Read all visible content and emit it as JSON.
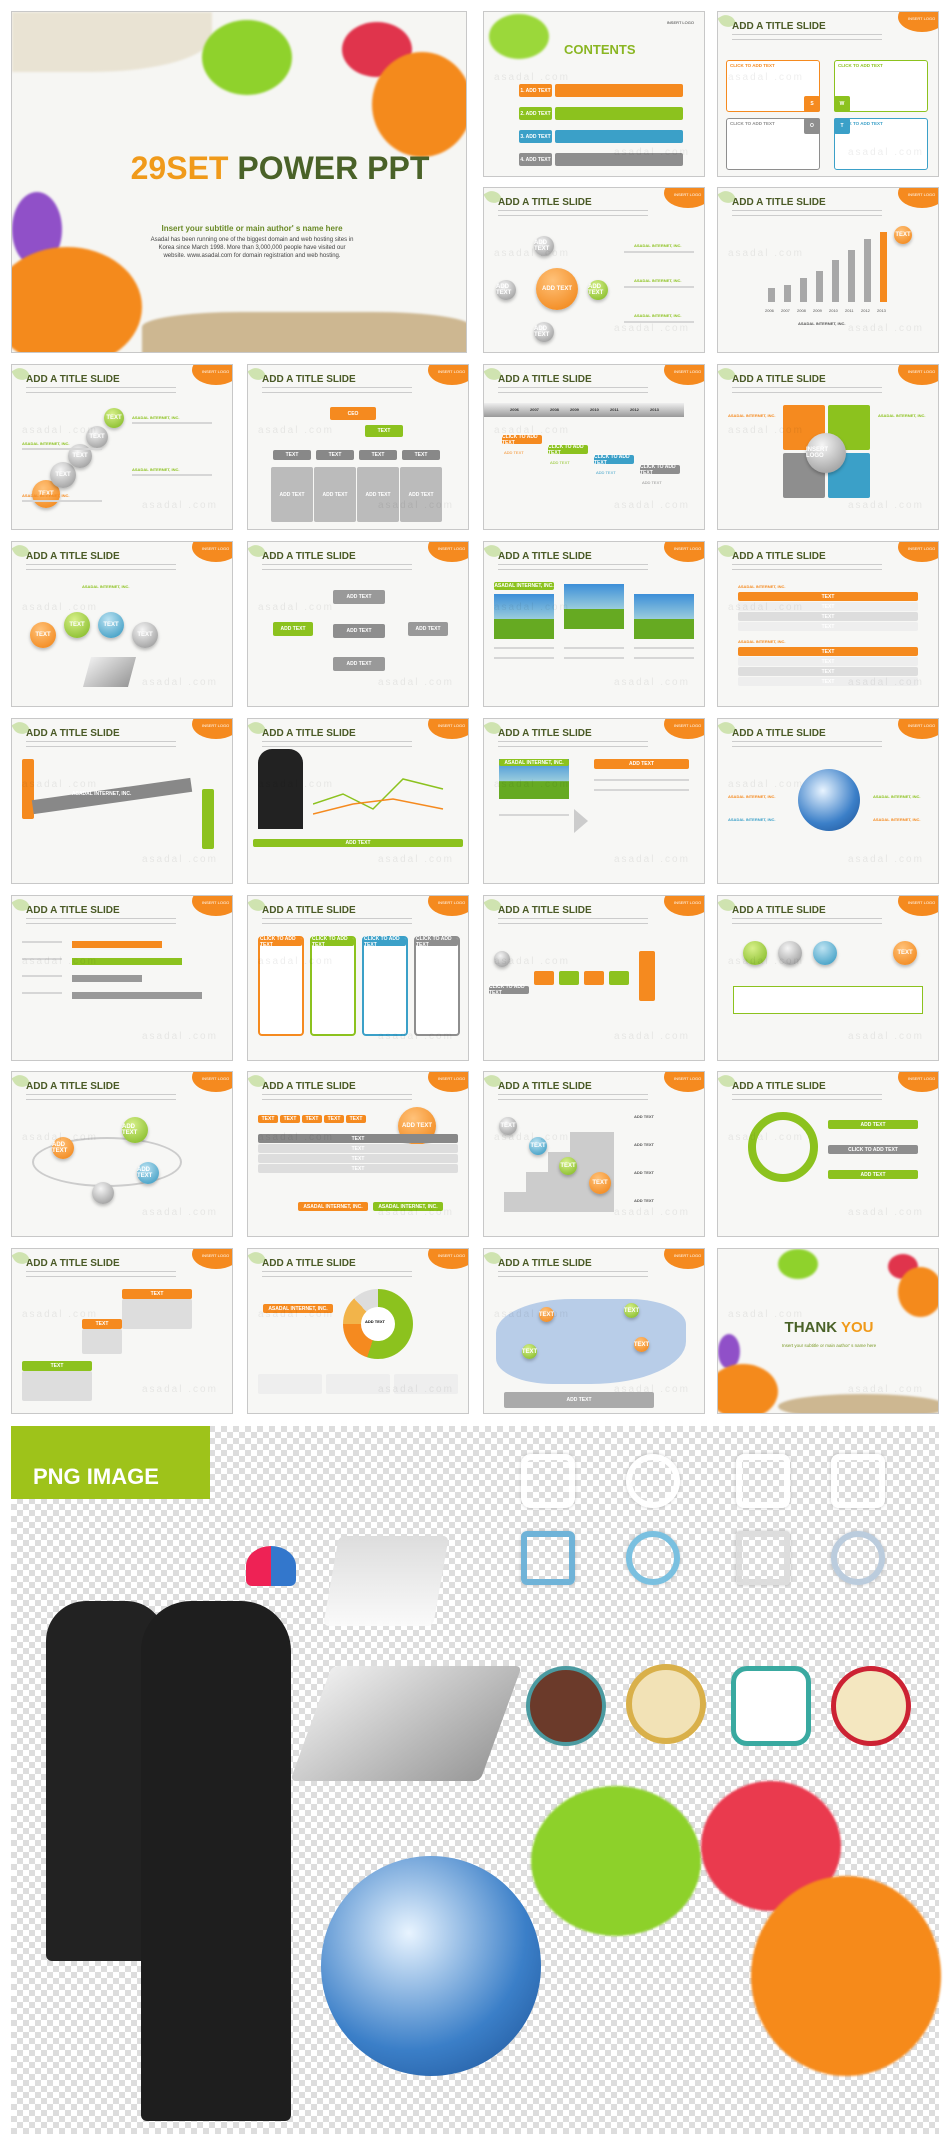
{
  "title_slide": {
    "title_a": "29SET",
    "title_b": "POWER PPT",
    "subtitle": "Insert your subtitle or main author'  s name here",
    "body": "Asadal has been running one of the biggest domain and web hosting sites in Korea since March 1998. More than 3,000,000 people have visited our website. www.asadal.com for domain  registration and web hosting.",
    "watermark": "asadal.com"
  },
  "common": {
    "slide_title": "ADD A TITLE SLIDE",
    "logo": "INSERT LOGO",
    "watermark": "asadal .com"
  },
  "contents_slide": {
    "title": "CONTENTS",
    "items": [
      "1. ADD TEXT",
      "2. ADD TEXT",
      "3. ADD TEXT",
      "4. ADD TEXT"
    ]
  },
  "swot": {
    "heading": "CLICK TO ADD TEXT",
    "letters": [
      "S",
      "W",
      "O",
      "T"
    ]
  },
  "cycle": {
    "center": "ADD TEXT",
    "center_sub": "CLICK TO ADD TEXT",
    "node": "ADD TEXT",
    "caption": "ASADAL INTERNET, INC."
  },
  "bar_chart": {
    "years": [
      "2006",
      "2007",
      "2008",
      "2009",
      "2010",
      "2011",
      "2012",
      "2013"
    ],
    "values": [
      2,
      2.5,
      3.5,
      4.5,
      6,
      7.5,
      9,
      10
    ],
    "badge": "TEXT",
    "caption": "ASADAL INTERNET, INC."
  },
  "steps": {
    "label": "TEXT",
    "caption": "ASADAL INTERNET, INC."
  },
  "org": {
    "ceo": "CEO",
    "sub": "TEXT",
    "cols": [
      "TEXT",
      "TEXT",
      "TEXT",
      "TEXT"
    ],
    "heads": [
      "ADD TEXT",
      "ADD TEXT",
      "ADD TEXT",
      "ADD TEXT"
    ]
  },
  "timeline": {
    "years": [
      "2006",
      "2007",
      "2008",
      "2009",
      "2010",
      "2011",
      "2012",
      "2013"
    ],
    "tags": [
      "CLICK TO ADD TEXT",
      "CLICK TO ADD TEXT",
      "CLICK TO ADD TEXT",
      "CLICK TO ADD TEXT"
    ],
    "item": "ADD TEXT"
  },
  "insert_logo": {
    "center": "INSERT LOGO",
    "caption": "ASADAL INTERNET, INC."
  },
  "generic": {
    "text": "TEXT",
    "add_text": "ADD TEXT",
    "click": "CLICK TO ADD TEXT",
    "company": "ASADAL INTERNET, INC."
  },
  "thank_you": {
    "a": "THANK",
    "b": "YOU",
    "subtitle": "Insert your subtitle or main author'  s name here"
  },
  "png_section": {
    "label": "PNG IMAGE"
  },
  "colors": {
    "orange": "#f58a1f",
    "green": "#8cc21e",
    "blue": "#3ba0c8",
    "gray": "#8e8e8e",
    "dark_green": "#4a5a26"
  }
}
